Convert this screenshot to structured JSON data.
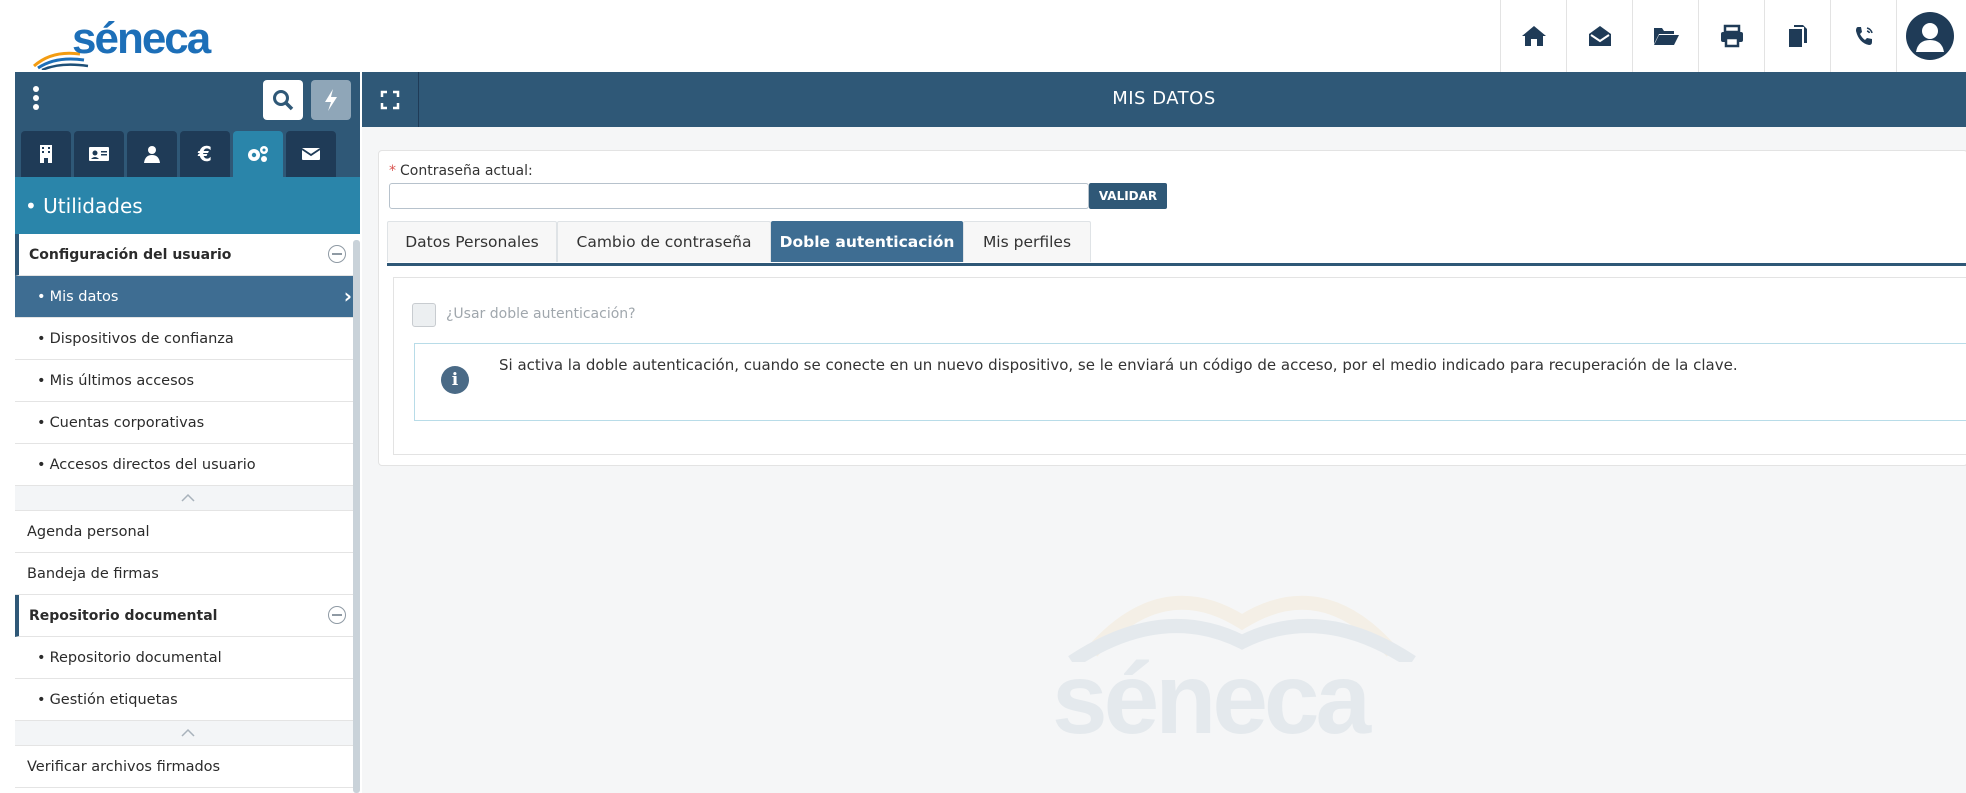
{
  "app": {
    "logo_text": "séneca"
  },
  "topbar": {
    "icons": [
      "home-icon",
      "envelope-open-icon",
      "folder-open-icon",
      "print-icon",
      "copy-icon",
      "phone-icon",
      "user-avatar-icon"
    ]
  },
  "sidebar": {
    "tabs": [
      "building-icon",
      "id-card-icon",
      "user-group-icon",
      "euro-icon",
      "gears-icon",
      "mail-icon"
    ],
    "active_tab_index": 4,
    "section_title": "• Utilidades",
    "groups": [
      {
        "label": "Configuración del usuario",
        "items": [
          "Mis datos",
          "Dispositivos de confianza",
          "Mis últimos accesos",
          "Cuentas corporativas",
          "Accesos directos del usuario"
        ]
      }
    ],
    "plain_items": [
      "Agenda personal",
      "Bandeja de firmas"
    ],
    "group2": {
      "label": "Repositorio documental",
      "items": [
        "Repositorio documental",
        "Gestión etiquetas"
      ]
    },
    "last_item": "Verificar archivos firmados"
  },
  "main": {
    "title": "MIS DATOS",
    "password_label": "Contraseña actual:",
    "password_value": "",
    "validate_label": "VALIDAR",
    "tabs": [
      "Datos Personales",
      "Cambio de contraseña",
      "Doble autenticación",
      "Mis perfiles"
    ],
    "active_tab": "Doble autenticación",
    "checkbox_label": "¿Usar doble autenticación?",
    "info_text": "Si activa la doble autenticación, cuando se conecte en un nuevo dispositivo, se le enviará un código de acceso, por el medio indicado para recuperación de la clave.",
    "watermark_text": "séneca"
  },
  "colors": {
    "primary_dark": "#2f5877",
    "accent_teal": "#2a85aa",
    "active_blue": "#3e6d92",
    "logo_blue": "#1d6fb8"
  }
}
